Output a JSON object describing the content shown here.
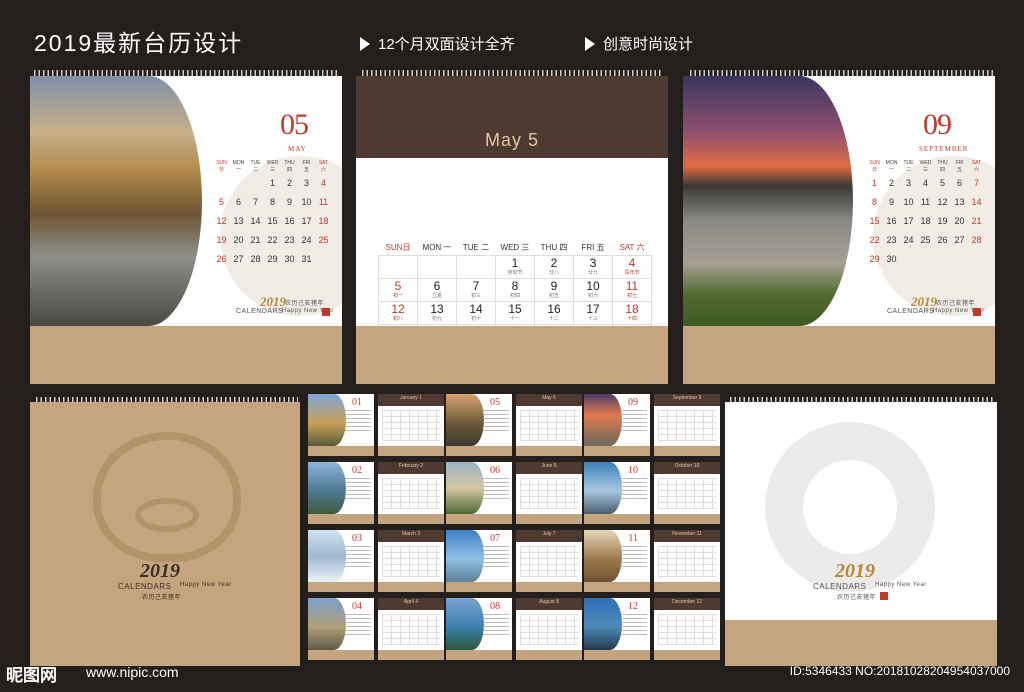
{
  "header": {
    "title": "2019最新台历设计",
    "feature1": "12个月双面设计全齐",
    "feature2": "创意时尚设计"
  },
  "weekdays_small": [
    "SUN日",
    "MON一",
    "TUE二",
    "WED三",
    "THU四",
    "FRI五",
    "SAT六"
  ],
  "may_small": {
    "num": "05",
    "name": "MAY",
    "days": [
      "",
      "",
      "",
      "1",
      "2",
      "3",
      "4",
      "5",
      "6",
      "7",
      "8",
      "9",
      "10",
      "11",
      "12",
      "13",
      "14",
      "15",
      "16",
      "17",
      "18",
      "19",
      "20",
      "21",
      "22",
      "23",
      "24",
      "25",
      "26",
      "27",
      "28",
      "29",
      "30",
      "31"
    ]
  },
  "sep_small": {
    "num": "09",
    "name": "SEPTEMBER",
    "days": [
      "1",
      "2",
      "3",
      "4",
      "5",
      "6",
      "7",
      "8",
      "9",
      "10",
      "11",
      "12",
      "13",
      "14",
      "15",
      "16",
      "17",
      "18",
      "19",
      "20",
      "21",
      "22",
      "23",
      "24",
      "25",
      "26",
      "27",
      "28",
      "29",
      "30"
    ]
  },
  "center": {
    "title": "May 5",
    "weekdays": [
      "SUN日",
      "MON 一",
      "TUE 二",
      "WED 三",
      "THU 四",
      "FRI 五",
      "SAT 六"
    ],
    "days": [
      [
        "",
        ""
      ],
      [
        "",
        ""
      ],
      [
        "",
        ""
      ],
      [
        "1",
        "劳动节"
      ],
      [
        "2",
        "廿八"
      ],
      [
        "3",
        "廿九"
      ],
      [
        "4",
        "青年节"
      ],
      [
        "5",
        "初一"
      ],
      [
        "6",
        "立夏"
      ],
      [
        "7",
        "初三"
      ],
      [
        "8",
        "初四"
      ],
      [
        "9",
        "初五"
      ],
      [
        "10",
        "初六"
      ],
      [
        "11",
        "初七"
      ],
      [
        "12",
        "初八"
      ],
      [
        "13",
        "初九"
      ],
      [
        "14",
        "初十"
      ],
      [
        "15",
        "十一"
      ],
      [
        "16",
        "十二"
      ],
      [
        "17",
        "十三"
      ],
      [
        "18",
        "十四"
      ],
      [
        "19",
        "十五"
      ],
      [
        "20",
        "十六"
      ],
      [
        "21",
        "小满"
      ],
      [
        "22",
        "十八"
      ],
      [
        "23",
        "十九"
      ],
      [
        "24",
        "二十"
      ],
      [
        "25",
        "廿一"
      ],
      [
        "26",
        "廿二"
      ],
      [
        "27",
        "廿三"
      ],
      [
        "28",
        "廿四"
      ],
      [
        "29",
        "廿五"
      ],
      [
        "30",
        "廿六"
      ],
      [
        "31",
        "廿七"
      ],
      [
        "",
        ""
      ]
    ]
  },
  "thumbs": [
    {
      "num": "01",
      "label": "January 1"
    },
    {
      "num": "05",
      "label": "May 5"
    },
    {
      "num": "09",
      "label": "September 9"
    },
    {
      "num": "02",
      "label": "February 2"
    },
    {
      "num": "06",
      "label": "June 6"
    },
    {
      "num": "10",
      "label": "October 10"
    },
    {
      "num": "03",
      "label": "March 3"
    },
    {
      "num": "07",
      "label": "July 7"
    },
    {
      "num": "11",
      "label": "November 11"
    },
    {
      "num": "04",
      "label": "April 4"
    },
    {
      "num": "08",
      "label": "August 8"
    },
    {
      "num": "12",
      "label": "December 12"
    }
  ],
  "brand": {
    "year": "2019",
    "calendars": "CALENDARS",
    "happy": "Happy New Year",
    "cn": "农历己亥猪年"
  },
  "watermark": {
    "site": "昵图网",
    "url": "www.nipic.com",
    "id": "ID:5346433 NO:20181028204954037000"
  },
  "colors": {
    "accent_red": "#c0392b",
    "brown": "#4e3a30",
    "kraft": "#c4a57f",
    "gold": "#b8863a"
  }
}
